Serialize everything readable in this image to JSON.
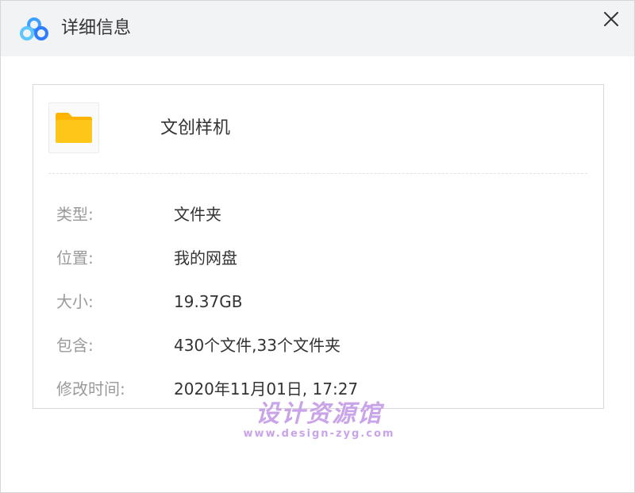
{
  "window": {
    "title": "详细信息",
    "app_icon": "baidu-netdisk-logo-icon",
    "close_icon": "close-icon"
  },
  "file": {
    "icon": "folder-icon",
    "name": "文创样机"
  },
  "details": [
    {
      "label": "类型:",
      "value": "文件夹"
    },
    {
      "label": "位置:",
      "value": "我的网盘"
    },
    {
      "label": "大小:",
      "value": "19.37GB"
    },
    {
      "label": "包含:",
      "value": "430个文件,33个文件夹"
    },
    {
      "label": "修改时间:",
      "value": "2020年11月01日, 17:27"
    }
  ],
  "watermark": {
    "main": "设计资源馆",
    "sub": "www.design-zyg.com"
  },
  "colors": {
    "title_bar_bg": "#f2f3f5",
    "label_text": "#9a9a9a",
    "value_text": "#333333",
    "folder_yellow": "#ffc61a",
    "logo_blue": "#3fa0ff",
    "watermark": "#c9a4e8"
  }
}
